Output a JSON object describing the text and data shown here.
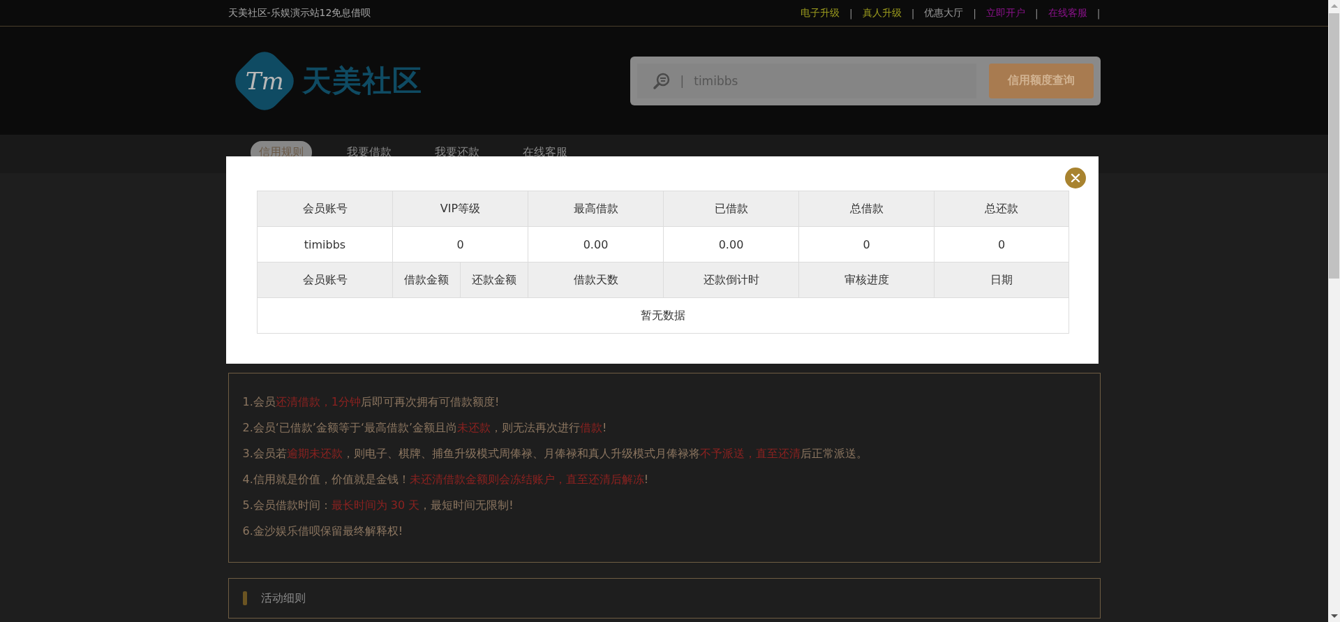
{
  "top_bar": {
    "title": "天美社区-乐娱演示站12免息借呗",
    "links": [
      {
        "label": "电子升级",
        "color": "#9a9a1e"
      },
      {
        "label": "真人升级",
        "color": "#9a9a1e"
      },
      {
        "label": "优惠大厅",
        "color": "#9a9a9a"
      },
      {
        "label": "立即开户",
        "color": "#8a128a"
      },
      {
        "label": "在线客服",
        "color": "#8a128a"
      }
    ],
    "separator": "|"
  },
  "header": {
    "logo_mark": "Tm",
    "logo_text": "天美社区",
    "search": {
      "value": "timibbs",
      "divider": "|"
    },
    "query_button": "信用额度查询"
  },
  "nav": [
    {
      "label": "信用规则",
      "selected": true
    },
    {
      "label": "我要借款",
      "selected": false
    },
    {
      "label": "我要还款",
      "selected": false
    },
    {
      "label": "在线客服",
      "selected": false
    }
  ],
  "modal": {
    "summary_columns": [
      "会员账号",
      "VIP等级",
      "最高借款",
      "已借款",
      "总借款",
      "总还款"
    ],
    "summary_row": [
      "timibbs",
      "0",
      "0.00",
      "0.00",
      "0",
      "0"
    ],
    "detail_columns": [
      "会员账号",
      "借款金额",
      "还款金额",
      "借款天数",
      "还款倒计时",
      "审核进度",
      "日期"
    ],
    "empty_text": "暂无数据"
  },
  "rules": [
    [
      {
        "text": "1.会员",
        "highlight": false
      },
      {
        "text": "还清借款，1分钟",
        "highlight": true
      },
      {
        "text": "后即可再次拥有可借款额度!",
        "highlight": false
      }
    ],
    [
      {
        "text": "2.会员‘已借款’金额等于‘最高借款’金额且尚",
        "highlight": false
      },
      {
        "text": "未还款",
        "highlight": true
      },
      {
        "text": "，则无法再次进行",
        "highlight": false
      },
      {
        "text": "借款",
        "highlight": true
      },
      {
        "text": "!",
        "highlight": false
      }
    ],
    [
      {
        "text": "3.会员若",
        "highlight": false
      },
      {
        "text": "逾期未还款",
        "highlight": true
      },
      {
        "text": "，则电子、棋牌、捕鱼升级模式周俸禄、月俸禄和真人升级模式月俸禄将",
        "highlight": false
      },
      {
        "text": "不予派送，直至还清",
        "highlight": true
      },
      {
        "text": "后正常派送。",
        "highlight": false
      }
    ],
    [
      {
        "text": "4.信用就是价值，价值就是金钱！",
        "highlight": false
      },
      {
        "text": "未还清借款金额则会冻结账户，直至还清后解冻",
        "highlight": true
      },
      {
        "text": "!",
        "highlight": false
      }
    ],
    [
      {
        "text": "5.会员借款时间：",
        "highlight": false
      },
      {
        "text": "最长时间为 30 天",
        "highlight": true
      },
      {
        "text": "，最短时间无限制!",
        "highlight": false
      }
    ],
    [
      {
        "text": "6.金沙娱乐借呗保留最终解释权!",
        "highlight": false
      }
    ]
  ],
  "section": {
    "title": "活动细则"
  }
}
